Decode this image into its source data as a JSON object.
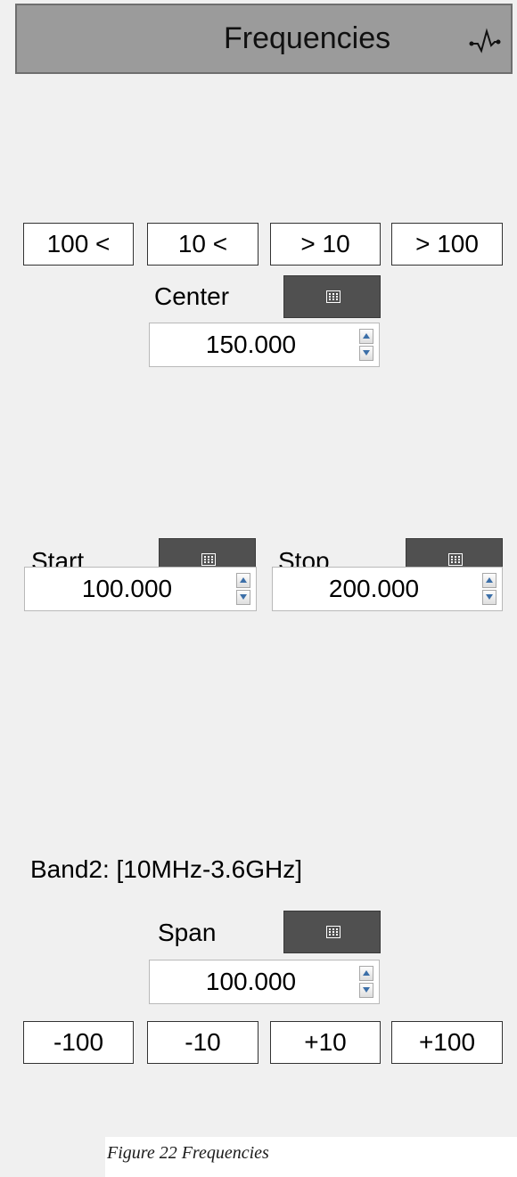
{
  "header": {
    "title": "Frequencies",
    "icon": "waveform-icon"
  },
  "center_steps": [
    "100 <",
    "10 <",
    "> 10",
    "> 100"
  ],
  "center": {
    "label": "Center",
    "value": "150.000",
    "keypad_icon": "keypad-icon"
  },
  "start": {
    "label": "Start",
    "value": "100.000",
    "keypad_icon": "keypad-icon"
  },
  "stop": {
    "label": "Stop",
    "value": "200.000",
    "keypad_icon": "keypad-icon"
  },
  "band_text": "Band2: [10MHz-3.6GHz]",
  "span": {
    "label": "Span",
    "value": "100.000",
    "keypad_icon": "keypad-icon"
  },
  "span_steps": [
    "-100",
    "-10",
    "+10",
    "+100"
  ],
  "caption": "Figure 22 Frequencies",
  "colors": {
    "panel_background": "#f0f0f0",
    "header_background": "#9b9b9b",
    "keypad_button": "#505050",
    "spin_arrow": "#3c6fa8"
  }
}
